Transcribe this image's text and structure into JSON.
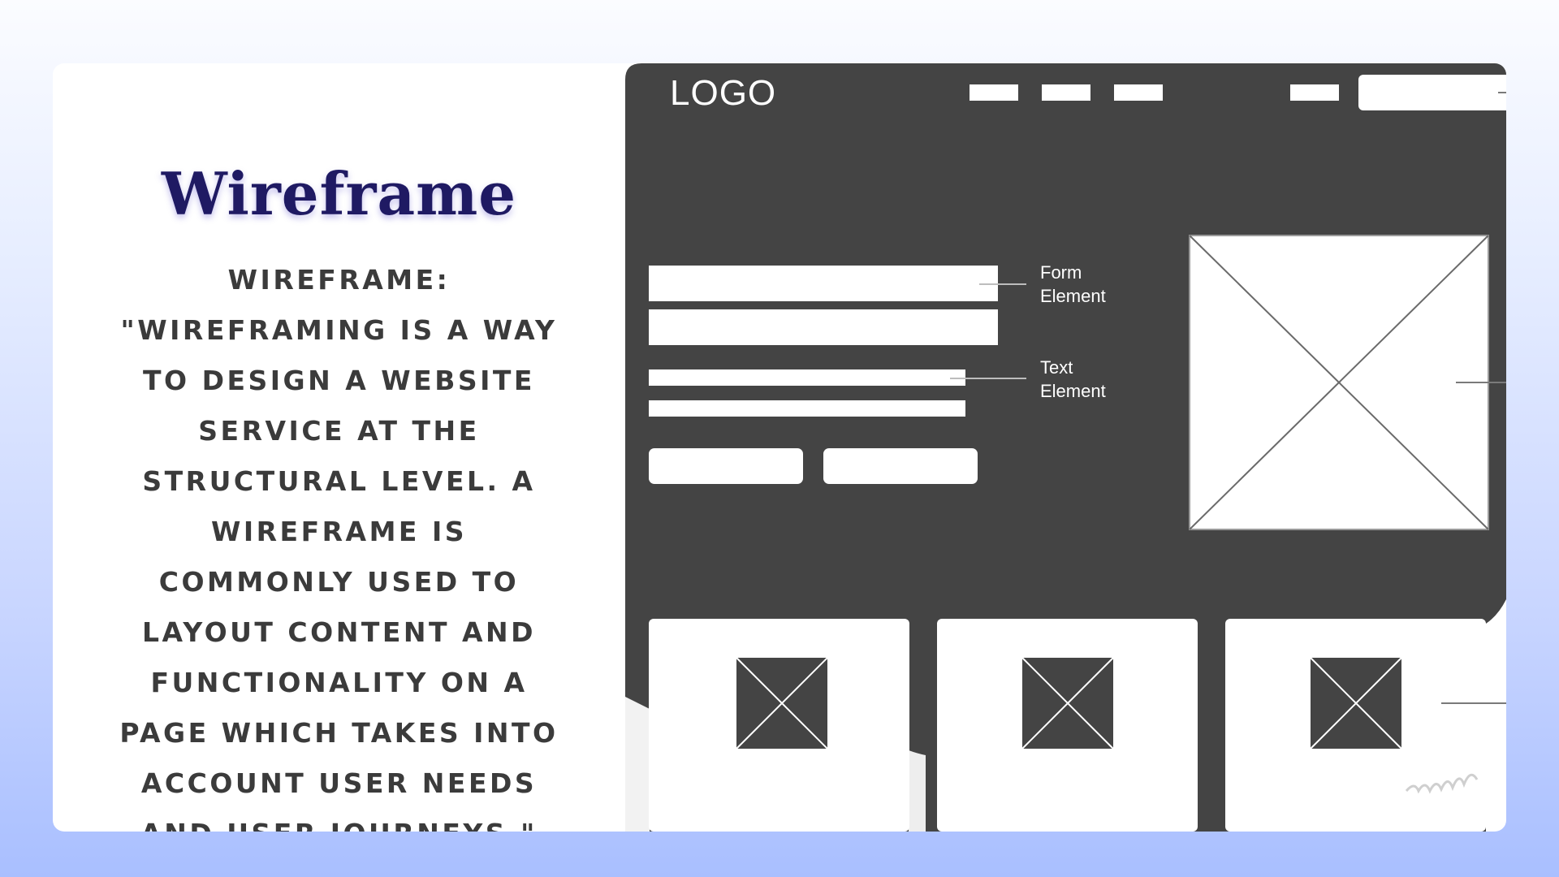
{
  "title": "Wireframe",
  "body": "Wireframe: \"Wireframing is a way to design a website service at the structural level. A wireframe is commonly used to layout content and functionality on a page which takes into account user needs and user journeys.\"",
  "mockup": {
    "logo": "LOGO",
    "annotations": {
      "form_line1": "Form",
      "form_line2": "Element",
      "text_line1": "Text",
      "text_line2": "Element"
    },
    "nav_item_count": 4
  },
  "colors": {
    "background_top": "#fbfcff",
    "background_bottom": "#a9bfff",
    "title": "#1f1a63",
    "body_text": "#3b3b3b",
    "mockup_dark": "#444444",
    "mockup_light": "#ffffff"
  },
  "icons": [
    "image-placeholder-icon"
  ]
}
